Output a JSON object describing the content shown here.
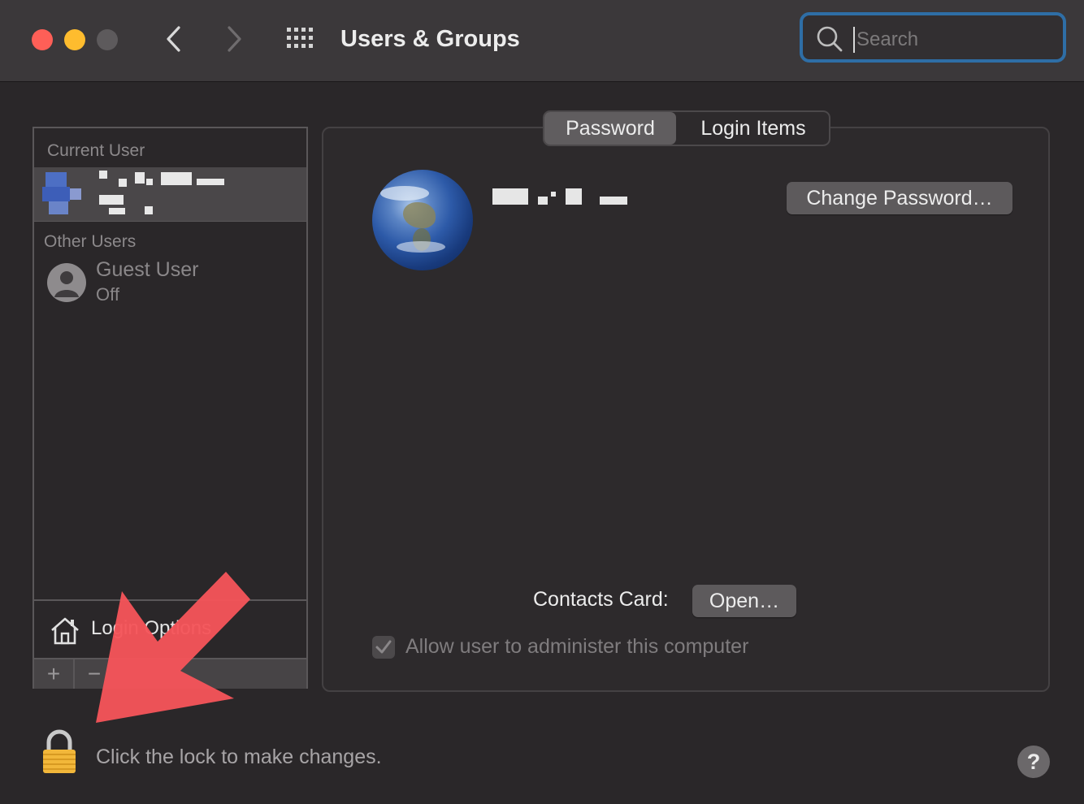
{
  "window": {
    "title": "Users & Groups",
    "search_placeholder": "Search"
  },
  "sidebar": {
    "current_user_label": "Current User",
    "other_users_label": "Other Users",
    "guest": {
      "name": "Guest User",
      "status": "Off"
    },
    "login_options_label": "Login Options",
    "add_label": "+",
    "remove_label": "−"
  },
  "tabs": [
    {
      "label": "Password",
      "selected": true
    },
    {
      "label": "Login Items",
      "selected": false
    }
  ],
  "main": {
    "change_password_label": "Change Password…",
    "contacts_card_label": "Contacts Card:",
    "open_label": "Open…",
    "admin_checkbox_label": "Allow user to administer this computer",
    "admin_checked": true
  },
  "footer": {
    "lock_text": "Click the lock to make changes.",
    "help_label": "?"
  },
  "annotation": {
    "arrow_color": "#f5545a"
  },
  "colors": {
    "accent": "#2e6ea6",
    "close": "#fe5f57",
    "minimize": "#febc2e"
  }
}
